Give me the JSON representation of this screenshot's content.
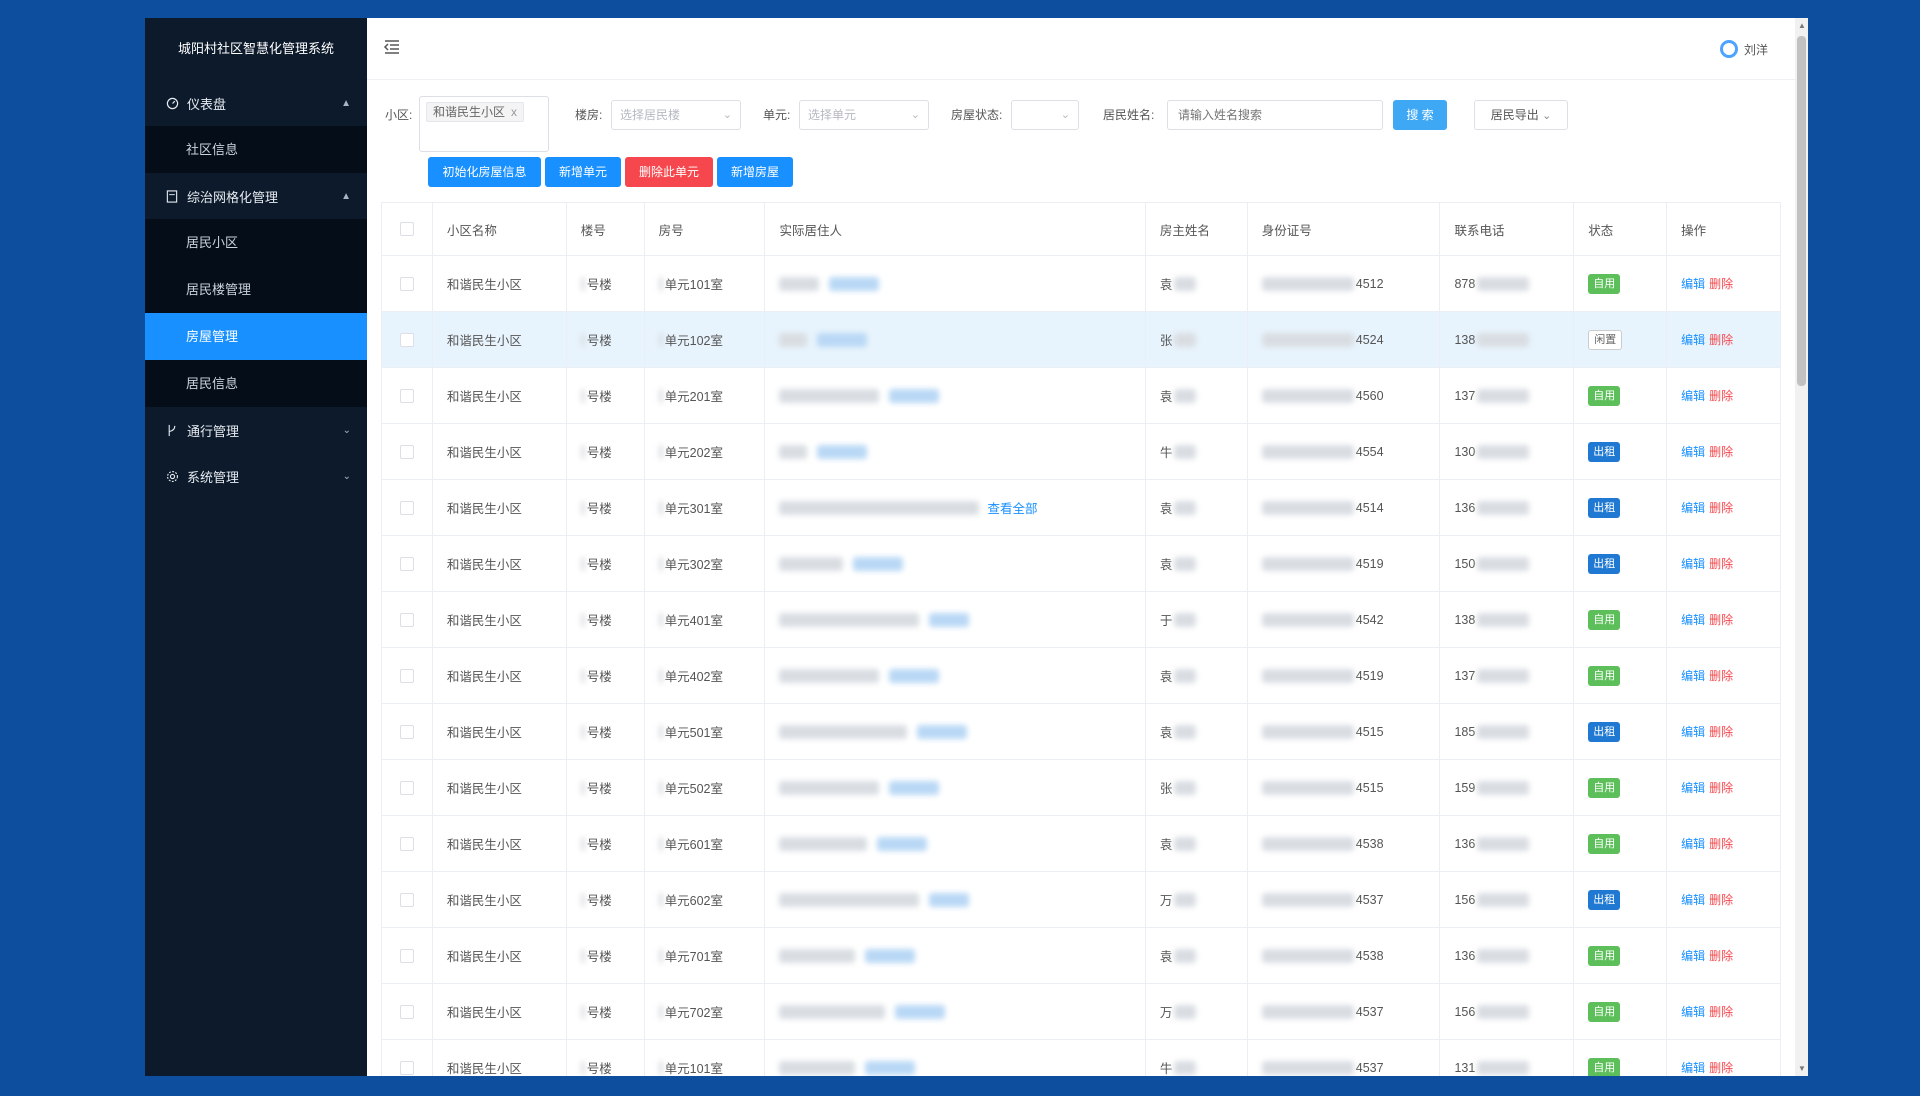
{
  "app": {
    "title": "城阳村社区智慧化管理系统",
    "user": "刘洋"
  },
  "sidebar": {
    "groups": [
      {
        "label": "仪表盘",
        "icon": "dashboard-icon",
        "arrow": "^",
        "items": [
          "社区信息"
        ]
      },
      {
        "label": "综治网格化管理",
        "icon": "document-icon",
        "arrow": "^",
        "items": [
          "居民小区",
          "居民楼管理",
          "房屋管理",
          "居民信息"
        ]
      },
      {
        "label": "通行管理",
        "icon": "branch-icon",
        "arrow": "v",
        "items": []
      },
      {
        "label": "系统管理",
        "icon": "gear-icon",
        "arrow": "v",
        "items": []
      }
    ],
    "active": "房屋管理"
  },
  "filters": {
    "community_label": "小区:",
    "community_tag": "和谐民生小区",
    "community_tag_close": "x",
    "building_label": "楼房:",
    "building_placeholder": "选择居民楼",
    "unit_label": "单元:",
    "unit_placeholder": "选择单元",
    "status_label": "房屋状态:",
    "status_value": "",
    "name_label": "居民姓名:",
    "name_placeholder": "请输入姓名搜索",
    "search_btn": "搜 索",
    "export_btn": "居民导出"
  },
  "actions": {
    "init": "初始化房屋信息",
    "add_unit": "新增单元",
    "del_unit": "删除此单元",
    "add_house": "新增房屋"
  },
  "table": {
    "headers": [
      "小区名称",
      "楼号",
      "房号",
      "实际居住人",
      "房主姓名",
      "身份证号",
      "联系电话",
      "状态",
      "操作"
    ],
    "edit_label": "编辑",
    "delete_label": "删除",
    "rows": [
      {
        "community": "和谐民生小区",
        "building": "号楼",
        "room": "单元101室",
        "owner": "袁",
        "id_tail": "4512",
        "phone": "878",
        "status": "自用",
        "status_type": "zy",
        "resident_w": 40,
        "link_w": 50,
        "link_text": ""
      },
      {
        "community": "和谐民生小区",
        "building": "号楼",
        "room": "单元102室",
        "owner": "张",
        "id_tail": "4524",
        "phone": "138",
        "status": "闲置",
        "status_type": "xz",
        "resident_w": 28,
        "link_w": 50,
        "link_text": "",
        "hl": true
      },
      {
        "community": "和谐民生小区",
        "building": "号楼",
        "room": "单元201室",
        "owner": "袁",
        "id_tail": "4560",
        "phone": "137",
        "status": "自用",
        "status_type": "zy",
        "resident_w": 100,
        "link_w": 50,
        "link_text": ""
      },
      {
        "community": "和谐民生小区",
        "building": "号楼",
        "room": "单元202室",
        "owner": "牛",
        "id_tail": "4554",
        "phone": "130",
        "status": "出租",
        "status_type": "cz",
        "resident_w": 28,
        "link_w": 50,
        "link_text": ""
      },
      {
        "community": "和谐民生小区",
        "building": "号楼",
        "room": "单元301室",
        "owner": "袁",
        "id_tail": "4514",
        "phone": "136",
        "status": "出租",
        "status_type": "cz",
        "resident_w": 200,
        "link_w": 0,
        "link_text": "查看全部"
      },
      {
        "community": "和谐民生小区",
        "building": "号楼",
        "room": "单元302室",
        "owner": "袁",
        "id_tail": "4519",
        "phone": "150",
        "status": "出租",
        "status_type": "cz",
        "resident_w": 64,
        "link_w": 50,
        "link_text": ""
      },
      {
        "community": "和谐民生小区",
        "building": "号楼",
        "room": "单元401室",
        "owner": "于",
        "id_tail": "4542",
        "phone": "138",
        "status": "自用",
        "status_type": "zy",
        "resident_w": 140,
        "link_w": 40,
        "link_text": ""
      },
      {
        "community": "和谐民生小区",
        "building": "号楼",
        "room": "单元402室",
        "owner": "袁",
        "id_tail": "4519",
        "phone": "137",
        "status": "自用",
        "status_type": "zy",
        "resident_w": 100,
        "link_w": 50,
        "link_text": ""
      },
      {
        "community": "和谐民生小区",
        "building": "号楼",
        "room": "单元501室",
        "owner": "袁",
        "id_tail": "4515",
        "phone": "185",
        "status": "出租",
        "status_type": "cz",
        "resident_w": 128,
        "link_w": 50,
        "link_text": ""
      },
      {
        "community": "和谐民生小区",
        "building": "号楼",
        "room": "单元502室",
        "owner": "张",
        "id_tail": "4515",
        "phone": "159",
        "status": "自用",
        "status_type": "zy",
        "resident_w": 100,
        "link_w": 50,
        "link_text": ""
      },
      {
        "community": "和谐民生小区",
        "building": "号楼",
        "room": "单元601室",
        "owner": "袁",
        "id_tail": "4538",
        "phone": "136",
        "status": "自用",
        "status_type": "zy",
        "resident_w": 88,
        "link_w": 50,
        "link_text": ""
      },
      {
        "community": "和谐民生小区",
        "building": "号楼",
        "room": "单元602室",
        "owner": "万",
        "id_tail": "4537",
        "phone": "156",
        "status": "出租",
        "status_type": "cz",
        "resident_w": 140,
        "link_w": 40,
        "link_text": ""
      },
      {
        "community": "和谐民生小区",
        "building": "号楼",
        "room": "单元701室",
        "owner": "袁",
        "id_tail": "4538",
        "phone": "136",
        "status": "自用",
        "status_type": "zy",
        "resident_w": 76,
        "link_w": 50,
        "link_text": ""
      },
      {
        "community": "和谐民生小区",
        "building": "号楼",
        "room": "单元702室",
        "owner": "万",
        "id_tail": "4537",
        "phone": "156",
        "status": "自用",
        "status_type": "zy",
        "resident_w": 106,
        "link_w": 50,
        "link_text": ""
      },
      {
        "community": "和谐民生小区",
        "building": "号楼",
        "room": "单元101室",
        "owner": "牛",
        "id_tail": "4537",
        "phone": "131",
        "status": "自用",
        "status_type": "zy",
        "resident_w": 76,
        "link_w": 50,
        "link_text": ""
      }
    ]
  },
  "colors": {
    "primary": "#1890ff",
    "danger": "#f5474d",
    "sidebar": "#0c1a2b",
    "page_bg": "#0d4f9e",
    "green": "#5cbf5a",
    "rent_blue": "#1f78d1"
  }
}
